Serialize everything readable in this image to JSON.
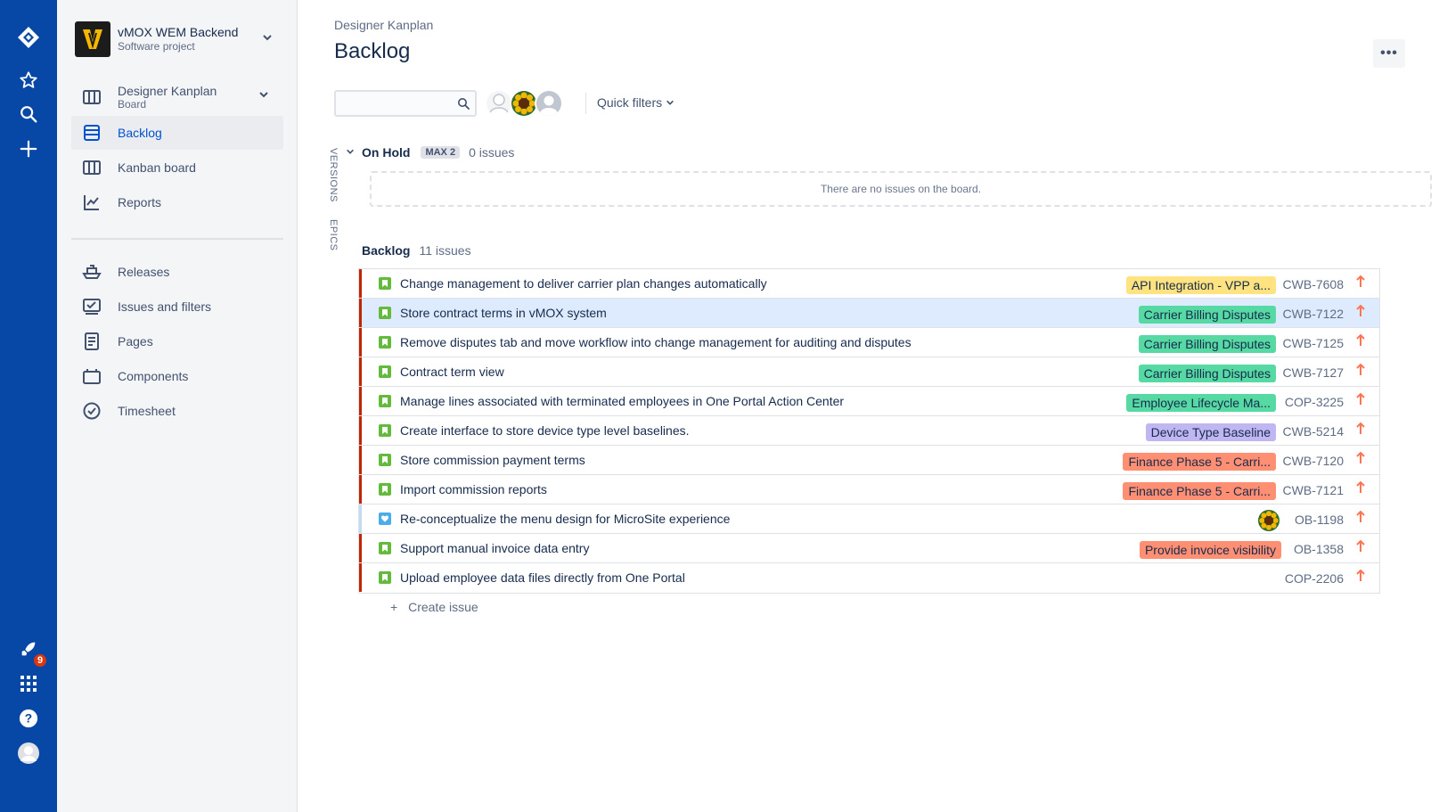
{
  "global_nav": {
    "icons": [
      "jira-logo-icon",
      "star-icon",
      "search-icon",
      "plus-icon",
      "rocket-icon",
      "app-switcher-icon",
      "help-icon",
      "profile-avatar-icon"
    ],
    "notification_count": "9",
    "bg_color": "#0747a6"
  },
  "sidebar": {
    "project_name": "vMOX WEM Backend",
    "project_type": "Software project",
    "board_name": "Designer Kanplan",
    "board_type": "Board",
    "items": [
      {
        "label": "Backlog",
        "icon": "backlog-icon",
        "active": true
      },
      {
        "label": "Kanban board",
        "icon": "board-icon"
      },
      {
        "label": "Reports",
        "icon": "reports-icon"
      },
      {
        "label": "Releases",
        "icon": "ship-icon"
      },
      {
        "label": "Issues and filters",
        "icon": "issues-icon"
      },
      {
        "label": "Pages",
        "icon": "page-icon"
      },
      {
        "label": "Components",
        "icon": "component-icon"
      },
      {
        "label": "Timesheet",
        "icon": "check-circle-icon"
      }
    ]
  },
  "header": {
    "breadcrumb": "Designer Kanplan",
    "title": "Backlog",
    "quick_filters": "Quick filters"
  },
  "side_tabs": {
    "versions": "VERSIONS",
    "epics": "EPICS"
  },
  "on_hold": {
    "name": "On Hold",
    "max": "MAX 2",
    "count": "0 issues",
    "empty": "There are no issues on the board."
  },
  "backlog": {
    "name": "Backlog",
    "count": "11 issues",
    "issues": [
      {
        "summary": "Change management to deliver carrier plan changes automatically",
        "epic": "API Integration - VPP a...",
        "epic_color": "#ffe380",
        "key": "CWB-7608",
        "type": "story"
      },
      {
        "summary": "Store contract terms in vMOX system",
        "epic": "Carrier Billing Disputes",
        "epic_color": "#57d9a3",
        "key": "CWB-7122",
        "type": "story"
      },
      {
        "summary": "Remove disputes tab and move workflow into change management for auditing and disputes",
        "epic": "Carrier Billing Disputes",
        "epic_color": "#57d9a3",
        "key": "CWB-7125",
        "type": "story"
      },
      {
        "summary": "Contract term view",
        "epic": "Carrier Billing Disputes",
        "epic_color": "#57d9a3",
        "key": "CWB-7127",
        "type": "story"
      },
      {
        "summary": "Manage lines associated with terminated employees in One Portal Action Center",
        "epic": "Employee Lifecycle Ma...",
        "epic_color": "#57d9a3",
        "key": "COP-3225",
        "type": "story"
      },
      {
        "summary": "Create interface to store device type level baselines.",
        "epic": "Device Type Baseline",
        "epic_color": "#c0b6f2",
        "key": "CWB-5214",
        "type": "story"
      },
      {
        "summary": "Store commission payment terms",
        "epic": "Finance Phase 5 - Carri...",
        "epic_color": "#ff8f73",
        "key": "CWB-7120",
        "type": "story"
      },
      {
        "summary": "Import commission reports",
        "epic": "Finance Phase 5 - Carri...",
        "epic_color": "#ff8f73",
        "key": "CWB-7121",
        "type": "story"
      },
      {
        "summary": "Re-conceptualize the menu design for MicroSite experience",
        "epic": "",
        "epic_color": "",
        "key": "OB-1198",
        "type": "task"
      },
      {
        "summary": "Support manual invoice data entry",
        "epic": "Provide invoice visibility",
        "epic_color": "#ff8f73",
        "key": "OB-1358",
        "type": "story"
      },
      {
        "summary": "Upload employee data files directly from One Portal",
        "epic": "",
        "epic_color": "",
        "key": "COP-2206",
        "type": "story"
      }
    ],
    "create_issue": "Create issue"
  }
}
